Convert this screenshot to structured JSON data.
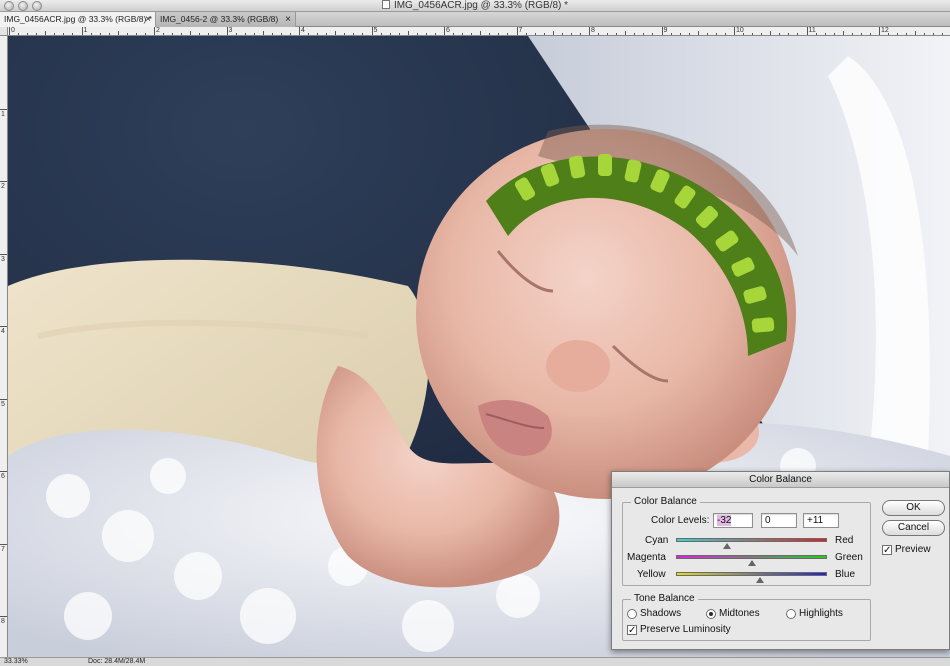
{
  "window": {
    "title": "IMG_0456ACR.jpg @ 33.3% (RGB/8) *"
  },
  "tabs": [
    {
      "label": "IMG_0456ACR.jpg @ 33.3% (RGB/8) *",
      "close": "×"
    },
    {
      "label": "IMG_0456-2 @ 33.3% (RGB/8)",
      "close": "×"
    }
  ],
  "ruler": {
    "top_numbers": [
      "0",
      "1",
      "2",
      "3",
      "4",
      "5",
      "6",
      "7",
      "8",
      "9",
      "10",
      "11",
      "12"
    ],
    "left_numbers": [
      "1",
      "2",
      "3",
      "4",
      "5",
      "6",
      "7",
      "8"
    ]
  },
  "status": {
    "zoom": "33.33%",
    "doc": "Doc: 28.4M/28.4M"
  },
  "dialog": {
    "title": "Color Balance",
    "color_balance_group": "Color Balance",
    "color_levels_label": "Color Levels:",
    "levels": [
      "-32",
      "0",
      "+11"
    ],
    "sliders": [
      {
        "left": "Cyan",
        "right": "Red",
        "value": -32,
        "colors": [
          "#3ad0d0",
          "#dd2222"
        ]
      },
      {
        "left": "Magenta",
        "right": "Green",
        "value": 0,
        "colors": [
          "#dd22dd",
          "#22cc22"
        ]
      },
      {
        "left": "Yellow",
        "right": "Blue",
        "value": 11,
        "colors": [
          "#dddd22",
          "#2222cc"
        ]
      }
    ],
    "tone_balance_group": "Tone Balance",
    "tones": [
      {
        "label": "Shadows",
        "selected": false
      },
      {
        "label": "Midtones",
        "selected": true
      },
      {
        "label": "Highlights",
        "selected": false
      }
    ],
    "preserve_luminosity": {
      "label": "Preserve Luminosity",
      "checked": true
    },
    "buttons": {
      "ok": "OK",
      "cancel": "Cancel"
    },
    "preview": {
      "label": "Preview",
      "checked": true
    }
  },
  "colors": {
    "background_dark_blue": "#1e2a40",
    "headband_green": "#5a8a1f",
    "headband_bright": "#a6d63a"
  },
  "icons": [
    "close-icon",
    "document-icon",
    "checkmark-icon",
    "slider-thumb-icon"
  ]
}
